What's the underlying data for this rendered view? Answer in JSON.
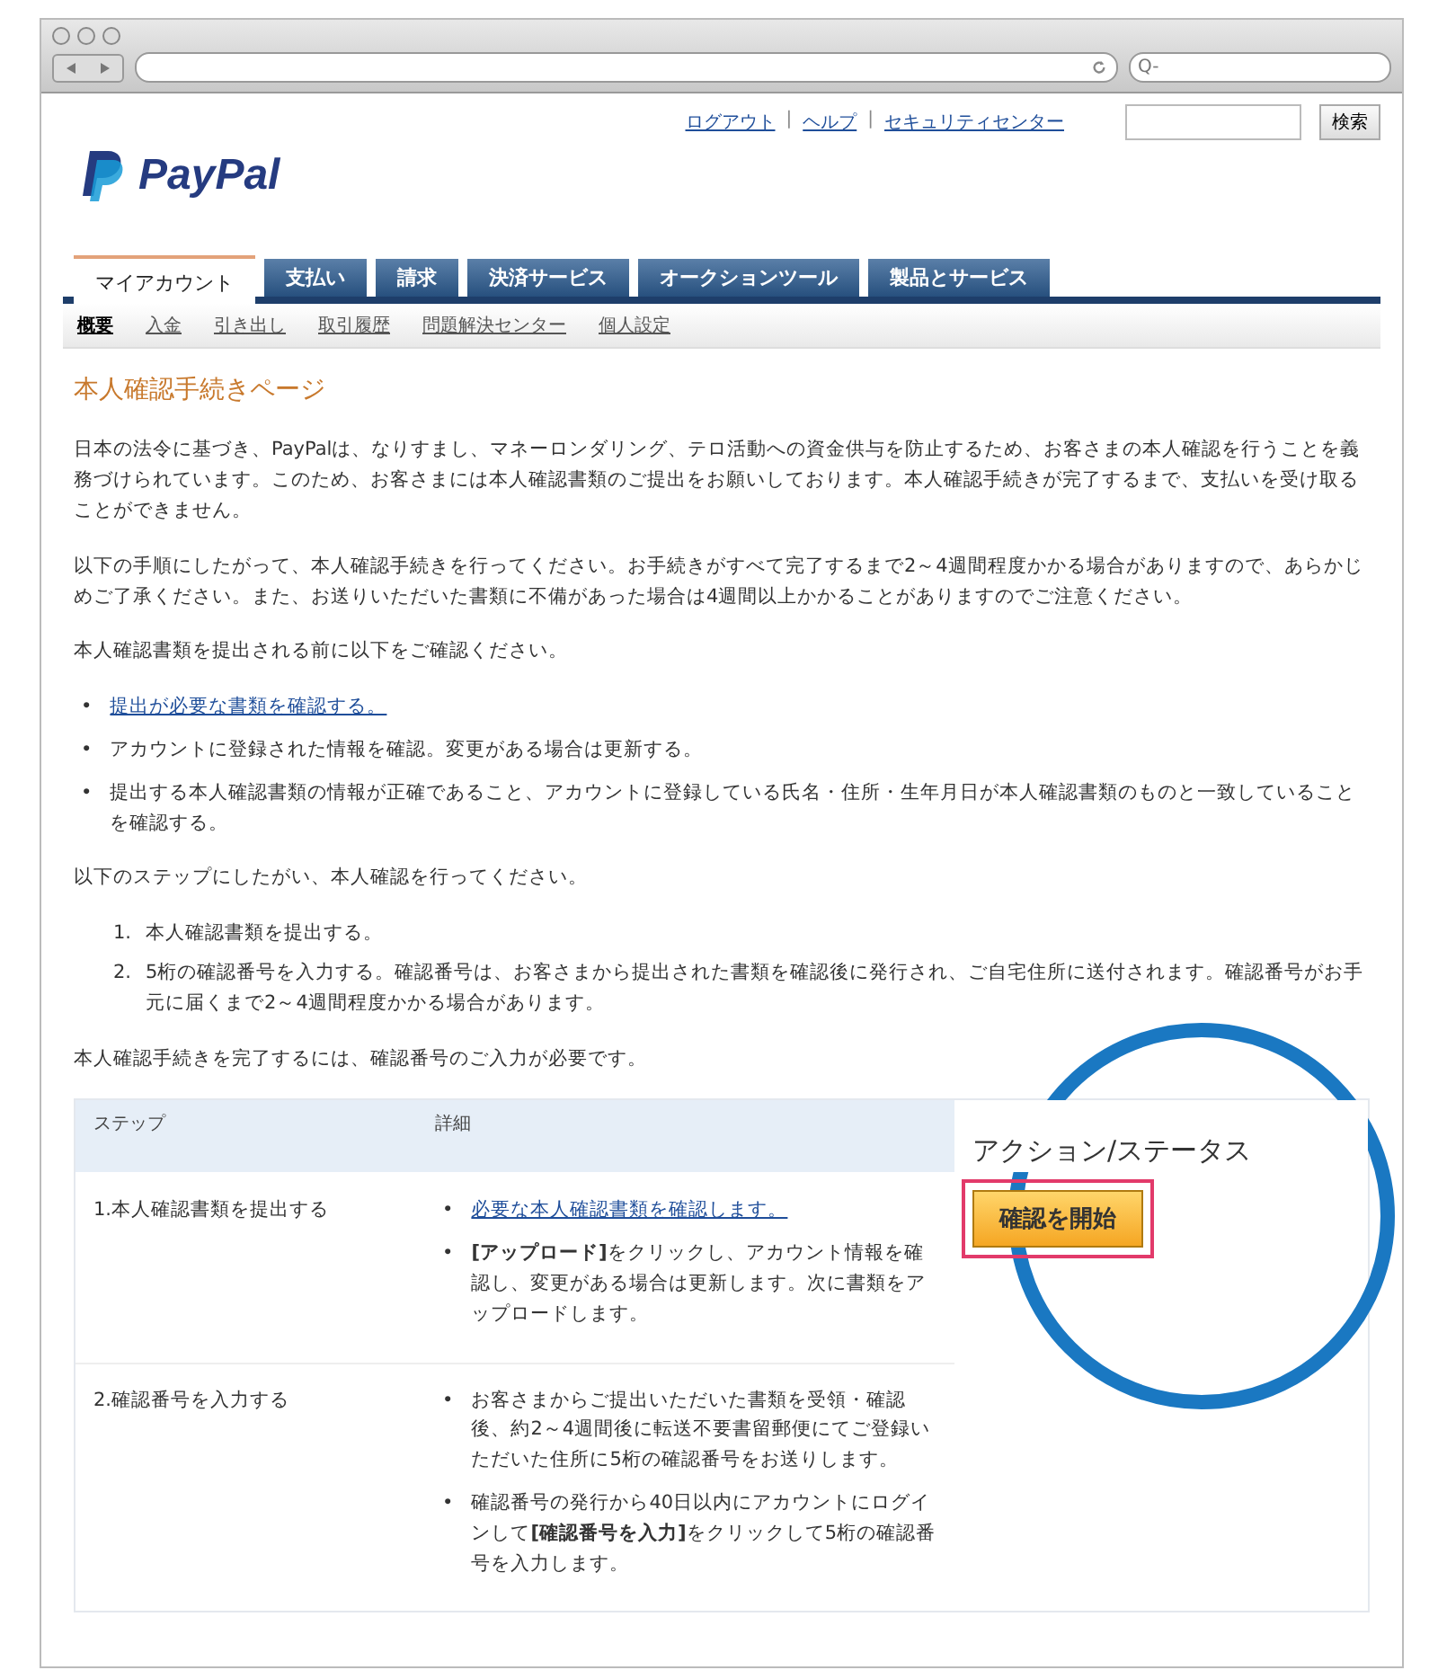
{
  "browser": {
    "search_placeholder": "Q-"
  },
  "top_links": [
    "ログアウト",
    "ヘルプ",
    "セキュリティセンター"
  ],
  "top_link_separator": "|",
  "bullet": "•",
  "site_search": {
    "button": "検索"
  },
  "logo": {
    "text": "PayPal"
  },
  "tabs": [
    {
      "label": "マイアカウント",
      "selected": true
    },
    {
      "label": "支払い",
      "selected": false
    },
    {
      "label": "請求",
      "selected": false
    },
    {
      "label": "決済サービス",
      "selected": false
    },
    {
      "label": "オークションツール",
      "selected": false
    },
    {
      "label": "製品とサービス",
      "selected": false
    }
  ],
  "subnav": [
    {
      "label": "概要",
      "selected": true
    },
    {
      "label": "入金",
      "selected": false
    },
    {
      "label": "引き出し",
      "selected": false
    },
    {
      "label": "取引履歴",
      "selected": false
    },
    {
      "label": "問題解決センター",
      "selected": false
    },
    {
      "label": "個人設定",
      "selected": false
    }
  ],
  "heading": "本人確認手続きページ",
  "intro": [
    "日本の法令に基づき、PayPalは、なりすまし、マネーロンダリング、テロ活動への資金供与を防止するため、お客さまの本人確認を行うことを義務づけられています。このため、お客さまには本人確認書類のご提出をお願いしております。本人確認手続きが完了するまで、支払いを受け取ることができません。",
    "以下の手順にしたがって、本人確認手続きを行ってください。お手続きがすべて完了するまで2～4週間程度かかる場合がありますので、あらかじめご了承ください。また、お送りいただいた書類に不備があった場合は4週間以上かかることがありますのでご注意ください。",
    "本人確認書類を提出される前に以下をご確認ください。"
  ],
  "checklist": [
    {
      "kind": "link",
      "text": "提出が必要な書類を確認する。"
    },
    {
      "kind": "text",
      "text": "アカウントに登録された情報を確認。変更がある場合は更新する。"
    },
    {
      "kind": "text",
      "text": "提出する本人確認書類の情報が正確であること、アカウントに登録している氏名・住所・生年月日が本人確認書類のものと一致していることを確認する。"
    }
  ],
  "steps_intro": "以下のステップにしたがい、本人確認を行ってください。",
  "steps": [
    {
      "number": "1.",
      "text": "本人確認書類を提出する。"
    },
    {
      "number": "2.",
      "text": "5桁の確認番号を入力する。確認番号は、お客さまから提出された書類を確認後に発行され、ご自宅住所に送付されます。確認番号がお手元に届くまで2～4週間程度かかる場合があります。"
    }
  ],
  "table_note": "本人確認手続きを完了するには、確認番号のご入力が必要です。",
  "table": {
    "columns": [
      "ステップ",
      "詳細",
      "アクション/ステータス"
    ],
    "rows": [
      {
        "step": "1.本人確認書類を提出する",
        "details": [
          {
            "kind": "link",
            "text": "必要な本人確認書類を確認します。"
          },
          {
            "kind": "text",
            "text": "**[アップロード]**をクリックし、アカウント情報を確認し、変更がある場合は更新します。次に書類をアップロードします。"
          }
        ],
        "action": "確認を開始"
      },
      {
        "step": "2.確認番号を入力する",
        "details": [
          {
            "kind": "text",
            "text": "お客さまからご提出いただいた書類を受領・確認後、約2～4週間後に転送不要書留郵便にてご登録いただいた住所に5桁の確認番号をお送りします。"
          },
          {
            "kind": "text",
            "text": "確認番号の発行から40日以内にアカウントにログインして**[確認番号を入力]**をクリックして5桁の確認番号を入力します。"
          }
        ]
      }
    ]
  }
}
